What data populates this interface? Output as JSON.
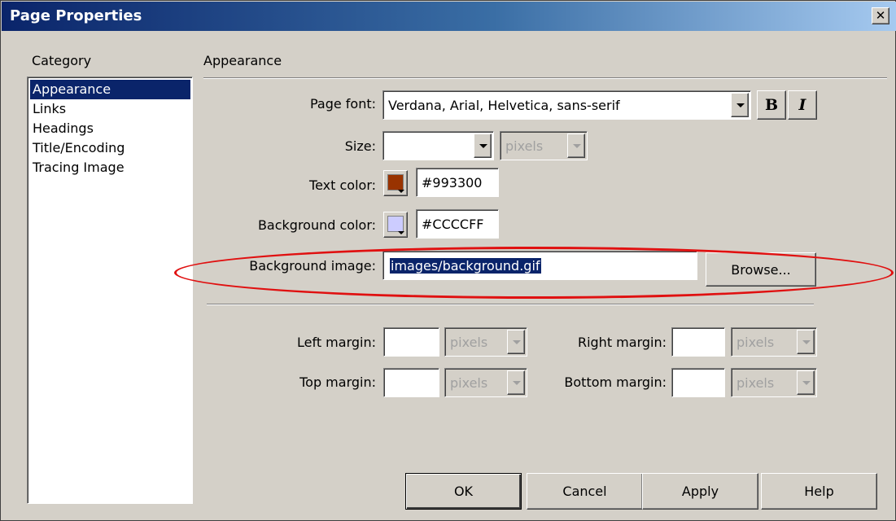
{
  "window": {
    "title": "Page Properties",
    "close_glyph": "✕"
  },
  "sidebar": {
    "heading": "Category",
    "items": [
      {
        "label": "Appearance",
        "selected": true
      },
      {
        "label": "Links",
        "selected": false
      },
      {
        "label": "Headings",
        "selected": false
      },
      {
        "label": "Title/Encoding",
        "selected": false
      },
      {
        "label": "Tracing Image",
        "selected": false
      }
    ]
  },
  "main": {
    "section_title": "Appearance",
    "page_font": {
      "label": "Page font:",
      "value": "Verdana, Arial, Helvetica, sans-serif",
      "bold_label": "B",
      "italic_label": "I"
    },
    "size": {
      "label": "Size:",
      "value": "",
      "unit": "pixels"
    },
    "text_color": {
      "label": "Text color:",
      "value": "#993300",
      "swatch": "#993300"
    },
    "background_color": {
      "label": "Background color:",
      "value": "#CCCCFF",
      "swatch": "#CCCCFF"
    },
    "background_image": {
      "label": "Background image:",
      "value": "images/background.gif",
      "browse_label": "Browse..."
    },
    "margins": {
      "left": {
        "label": "Left margin:",
        "value": "",
        "unit": "pixels"
      },
      "right": {
        "label": "Right margin:",
        "value": "",
        "unit": "pixels"
      },
      "top": {
        "label": "Top margin:",
        "value": "",
        "unit": "pixels"
      },
      "bottom": {
        "label": "Bottom margin:",
        "value": "",
        "unit": "pixels"
      }
    }
  },
  "buttons": {
    "ok": "OK",
    "cancel": "Cancel",
    "apply": "Apply",
    "help": "Help"
  },
  "colors": {
    "title_bar": "#0a246a",
    "dialog_face": "#d4d0c8",
    "selection": "#0a246a",
    "annotation": "#e01010"
  }
}
